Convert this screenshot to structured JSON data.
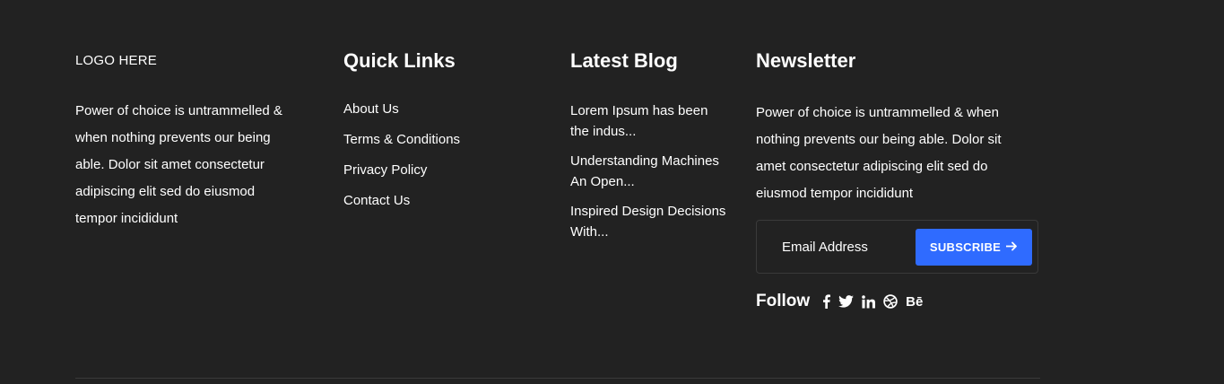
{
  "about": {
    "logo": "LOGO HERE",
    "text": "Power of choice is untrammelled & when nothing prevents our being able. Dolor sit amet consectetur adipiscing elit sed do eiusmod tempor incididunt"
  },
  "quick_links": {
    "heading": "Quick Links",
    "items": [
      {
        "label": "About Us"
      },
      {
        "label": "Terms & Conditions"
      },
      {
        "label": "Privacy Policy"
      },
      {
        "label": "Contact Us"
      }
    ]
  },
  "latest_blog": {
    "heading": "Latest Blog",
    "items": [
      {
        "title": "Lorem Ipsum has been the indus..."
      },
      {
        "title": "Understanding Machines An Open..."
      },
      {
        "title": "Inspired Design Decisions With..."
      }
    ]
  },
  "newsletter": {
    "heading": "Newsletter",
    "text": "Power of choice is untrammelled & when nothing prevents our being able. Dolor sit amet consectetur adipiscing elit sed do eiusmod tempor incididunt",
    "email_placeholder": "Email Address",
    "subscribe_label": "SUBSCRIBE",
    "subscribe_icon": "arrow-right-icon",
    "follow_label": "Follow",
    "social_icons": [
      "facebook-icon",
      "twitter-icon",
      "linkedin-icon",
      "dribbble-icon",
      "behance-icon"
    ],
    "behance_glyph": "Bē"
  },
  "colors": {
    "background": "#222222",
    "text": "#ffffff",
    "accent": "#2f6bff",
    "border": "#3a3a3a"
  }
}
